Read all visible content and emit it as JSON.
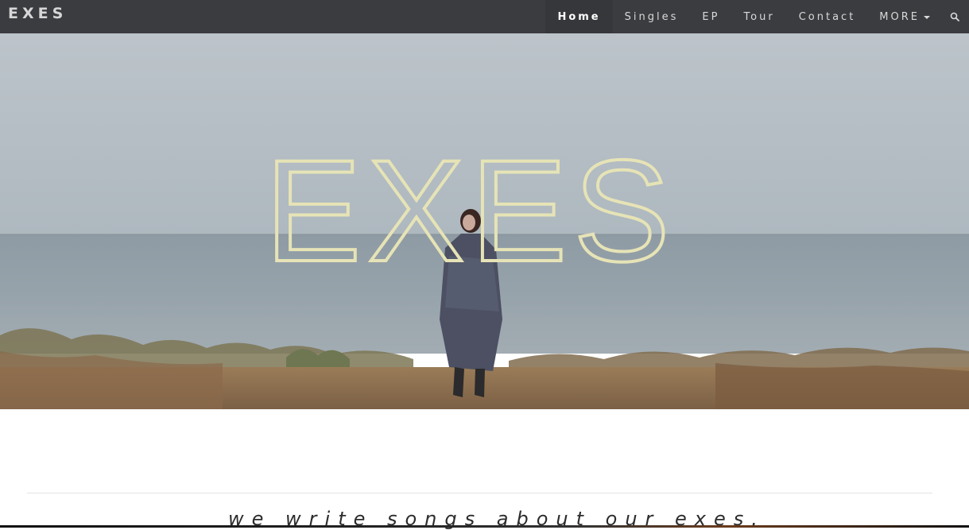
{
  "navbar": {
    "brand": "EXES",
    "items": [
      {
        "label": "Home",
        "active": true
      },
      {
        "label": "Singles",
        "active": false
      },
      {
        "label": "EP",
        "active": false
      },
      {
        "label": "Tour",
        "active": false
      },
      {
        "label": "Contact",
        "active": false
      },
      {
        "label": "MORE",
        "active": false
      }
    ],
    "search_icon": "search-icon",
    "more_icon": "caret-down-icon"
  },
  "hero": {
    "title": "EXES",
    "title_outline_color": "#e6e3b6"
  },
  "content": {
    "tagline": "we write songs about our exes."
  },
  "colors": {
    "navbar_bg": "#3b3c40",
    "sky": "#b3bcc2",
    "sea": "#8e9aa3",
    "ground": "#8b6f4e"
  }
}
